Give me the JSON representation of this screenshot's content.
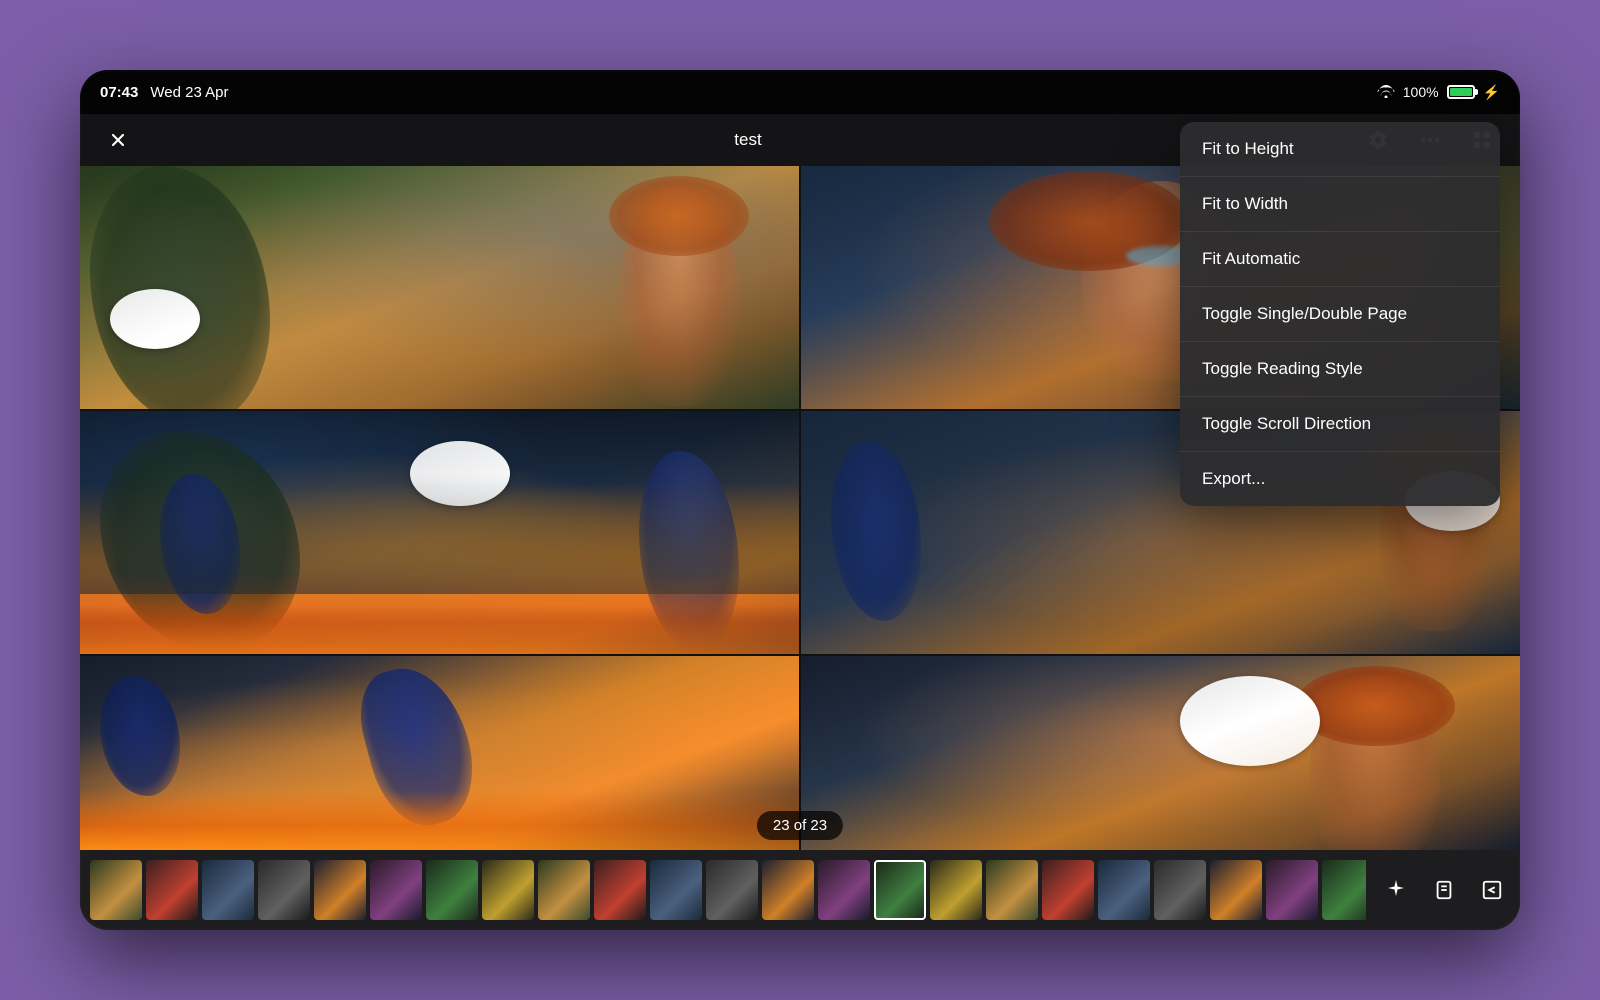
{
  "device": {
    "background_color": "#7b5ea7"
  },
  "status_bar": {
    "time": "07:43",
    "date": "Wed 23 Apr",
    "wifi": "WiFi",
    "battery_percent": "100%",
    "charging": true
  },
  "app_header": {
    "title": "test",
    "close_button_label": "✕",
    "more_button_label": "···",
    "gear_label": "Settings",
    "grid_label": "Grid View"
  },
  "context_menu": {
    "items": [
      {
        "id": "fit-height",
        "label": "Fit to Height"
      },
      {
        "id": "fit-width",
        "label": "Fit to Width"
      },
      {
        "id": "fit-auto",
        "label": "Fit Automatic"
      },
      {
        "id": "toggle-single-double",
        "label": "Toggle Single/Double Page"
      },
      {
        "id": "toggle-reading-style",
        "label": "Toggle Reading Style"
      },
      {
        "id": "toggle-scroll-dir",
        "label": "Toggle Scroll Direction"
      },
      {
        "id": "export",
        "label": "Export..."
      }
    ]
  },
  "page_indicator": {
    "text": "23 of 23"
  },
  "thumbnail_strip": {
    "icons": [
      {
        "id": "sparkle-icon",
        "symbol": "✦"
      },
      {
        "id": "single-page-icon",
        "symbol": "1"
      },
      {
        "id": "back-icon",
        "symbol": "⊡"
      }
    ],
    "thumbnails": [
      {
        "id": 1,
        "class": "thumb-bg-1",
        "active": false
      },
      {
        "id": 2,
        "class": "thumb-bg-2",
        "active": false
      },
      {
        "id": 3,
        "class": "thumb-bg-3",
        "active": false
      },
      {
        "id": 4,
        "class": "thumb-bg-4",
        "active": false
      },
      {
        "id": 5,
        "class": "thumb-bg-5",
        "active": false
      },
      {
        "id": 6,
        "class": "thumb-bg-6",
        "active": false
      },
      {
        "id": 7,
        "class": "thumb-bg-7",
        "active": false
      },
      {
        "id": 8,
        "class": "thumb-bg-8",
        "active": false
      },
      {
        "id": 9,
        "class": "thumb-bg-1",
        "active": false
      },
      {
        "id": 10,
        "class": "thumb-bg-2",
        "active": false
      },
      {
        "id": 11,
        "class": "thumb-bg-3",
        "active": false
      },
      {
        "id": 12,
        "class": "thumb-bg-4",
        "active": false
      },
      {
        "id": 13,
        "class": "thumb-bg-5",
        "active": false
      },
      {
        "id": 14,
        "class": "thumb-bg-6",
        "active": false
      },
      {
        "id": 15,
        "class": "thumb-bg-7",
        "active": true
      },
      {
        "id": 16,
        "class": "thumb-bg-8",
        "active": false
      },
      {
        "id": 17,
        "class": "thumb-bg-1",
        "active": false
      },
      {
        "id": 18,
        "class": "thumb-bg-2",
        "active": false
      },
      {
        "id": 19,
        "class": "thumb-bg-3",
        "active": false
      },
      {
        "id": 20,
        "class": "thumb-bg-4",
        "active": false
      },
      {
        "id": 21,
        "class": "thumb-bg-5",
        "active": false
      },
      {
        "id": 22,
        "class": "thumb-bg-6",
        "active": false
      },
      {
        "id": 23,
        "class": "thumb-bg-7",
        "active": false
      }
    ]
  }
}
